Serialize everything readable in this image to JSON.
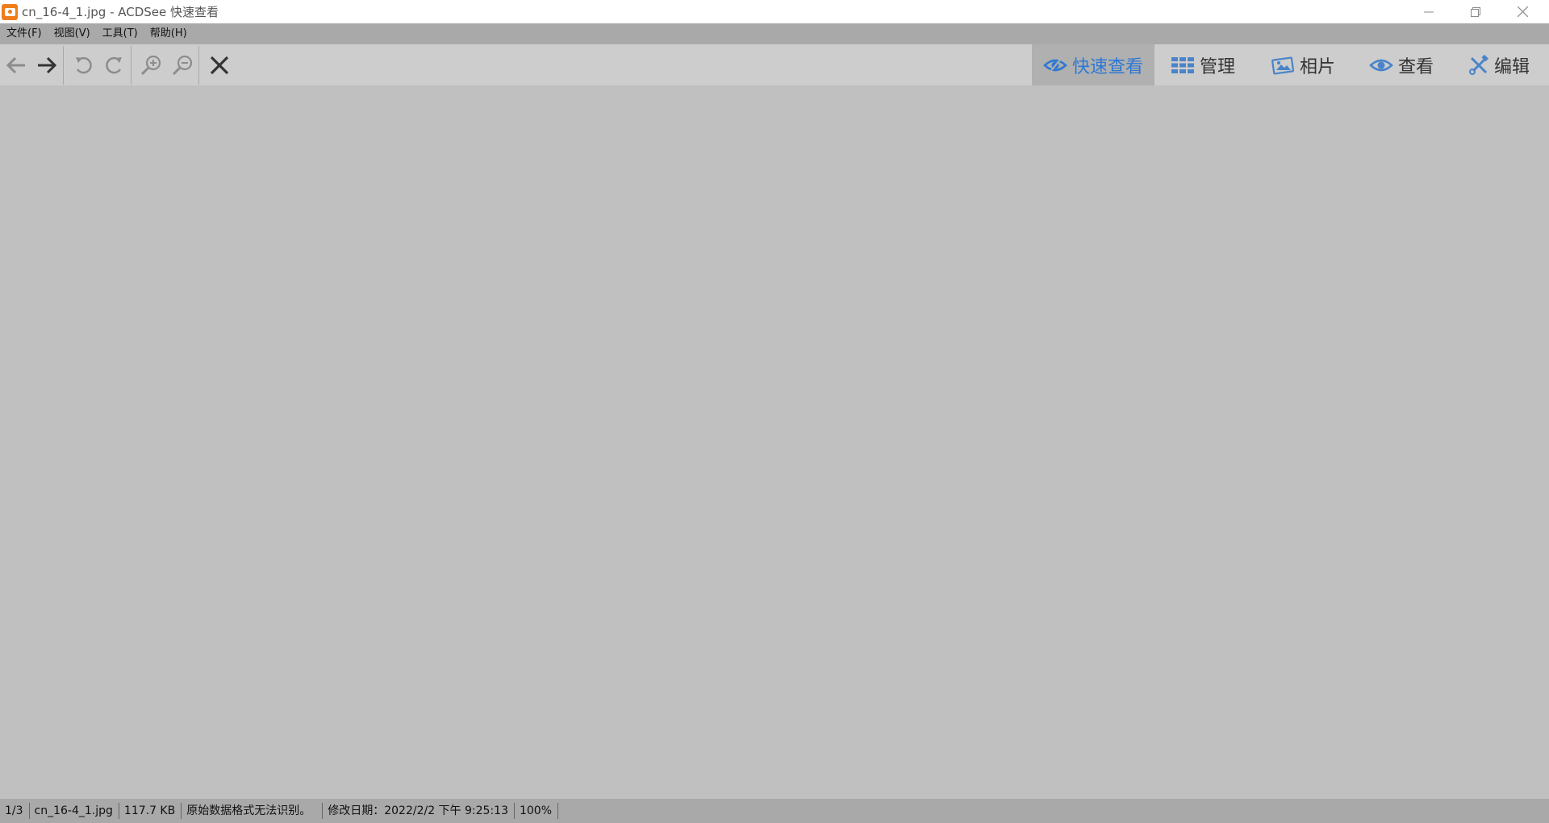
{
  "window": {
    "title": "cn_16-4_1.jpg - ACDSee 快速查看",
    "app_icon": "acdsee-icon"
  },
  "menu": {
    "items": [
      "文件(F)",
      "视图(V)",
      "工具(T)",
      "帮助(H)"
    ]
  },
  "toolbar": {
    "buttons": [
      "back-arrow-icon",
      "forward-arrow-icon",
      "rotate-left-icon",
      "rotate-right-icon",
      "zoom-in-icon",
      "zoom-out-icon",
      "close-icon"
    ]
  },
  "modes": [
    {
      "label": "快速查看",
      "icon": "eye-quick-icon",
      "active": true
    },
    {
      "label": "管理",
      "icon": "grid-icon",
      "active": false
    },
    {
      "label": "相片",
      "icon": "photo-icon",
      "active": false
    },
    {
      "label": "查看",
      "icon": "eye-icon",
      "active": false
    },
    {
      "label": "编辑",
      "icon": "edit-tools-icon",
      "active": false
    }
  ],
  "status": {
    "index": "1/3",
    "filename": "cn_16-4_1.jpg",
    "filesize": "117.7 KB",
    "message": "原始数据格式无法识别。",
    "modified": "修改日期：2022/2/2 下午 9:25:13",
    "zoom": "100%"
  },
  "colors": {
    "accent": "#2e78d2",
    "viewer_bg": "#c0c0c0",
    "toolbar_bg": "#cdcdcd",
    "bar_bg": "#a9a9a9"
  }
}
